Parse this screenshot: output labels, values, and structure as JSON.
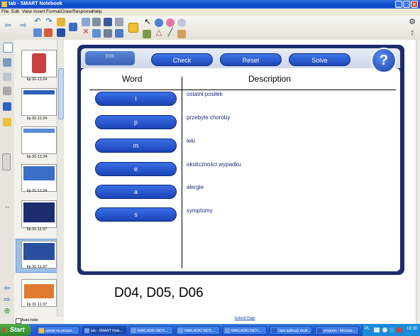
{
  "window": {
    "title": "tab - SMART Notebook"
  },
  "menu": [
    "File",
    "Edit",
    "View",
    "Insert",
    "Format",
    "Draw",
    "Response",
    "Help"
  ],
  "sorter": {
    "thumbnails": [
      {
        "label": "lip 31-11:24"
      },
      {
        "label": "lip 31-11:24"
      },
      {
        "label": "lip 31-11:24"
      },
      {
        "label": "lip 31-11:24"
      },
      {
        "label": "lip 31-11:37"
      },
      {
        "label": "lip 31-11:37"
      },
      {
        "label": "lip 31-11:37"
      }
    ],
    "auto_hide": "Auto-hide"
  },
  "activity": {
    "edit": "Edit",
    "check": "Check",
    "reset": "Reset",
    "solve": "Solve",
    "help": "?",
    "word_header": "Word",
    "desc_header": "Description",
    "rows": [
      {
        "word": "l",
        "description": "ostatni posiłek"
      },
      {
        "word": "p",
        "description": "przebyte choroby"
      },
      {
        "word": "m",
        "description": "leki"
      },
      {
        "word": "e",
        "description": "okoliczności wypadku"
      },
      {
        "word": "a",
        "description": "alergie"
      },
      {
        "word": "s",
        "description": "symptomy"
      }
    ]
  },
  "page_text": "D04, D05, D06",
  "extend_page": "Extend Page",
  "taskbar": {
    "start": "Start",
    "tasks": [
      "apetyt na przyjaz...",
      "tab - SMART Note...",
      "NAKLADKI INDY...",
      "NAKLADKI INDY...",
      "NAKLADKI INDY...",
      "Opis aplikacji multi...",
      "program - Microso..."
    ],
    "language": "PL",
    "clock": "18:39"
  }
}
